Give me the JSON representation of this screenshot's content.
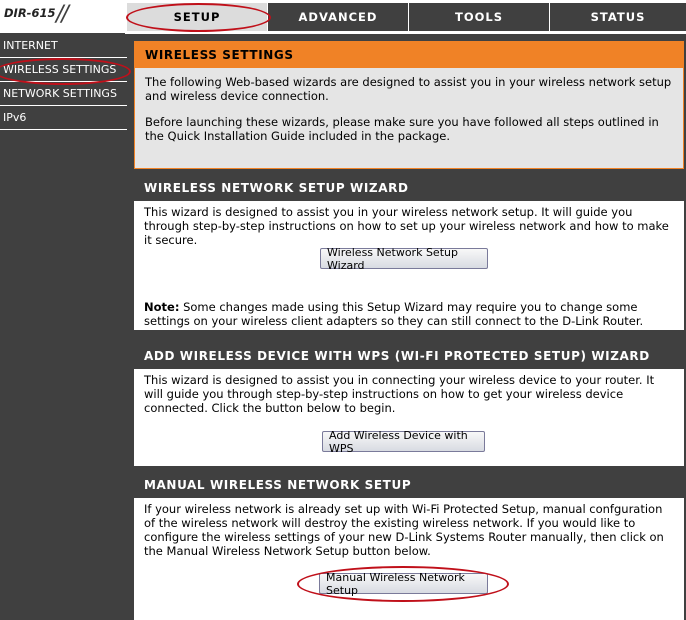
{
  "model": {
    "name": "DIR-615",
    "slashes": "//"
  },
  "tabs": [
    {
      "label": "SETUP",
      "active": true
    },
    {
      "label": "ADVANCED"
    },
    {
      "label": "TOOLS"
    },
    {
      "label": "STATUS"
    }
  ],
  "sidebar": {
    "items": [
      {
        "label": "INTERNET"
      },
      {
        "label": "WIRELESS SETTINGS",
        "active": true
      },
      {
        "label": "NETWORK SETTINGS"
      },
      {
        "label": "IPv6"
      }
    ]
  },
  "intro": {
    "title": "WIRELESS SETTINGS",
    "p1": "The following Web-based wizards are designed to assist you in your wireless network setup and wireless device connection.",
    "p2": "Before launching these wizards, please make sure you have followed all steps outlined in the Quick Installation Guide included in the package."
  },
  "wizard": {
    "title": "WIRELESS NETWORK SETUP WIZARD",
    "text": "This wizard is designed to assist you in your wireless network setup. It will guide you through step-by-step instructions on how to set up your wireless network and how to make it secure.",
    "button": "Wireless Network Setup Wizard",
    "note_label": "Note:",
    "note_text": " Some changes made using this Setup Wizard may require you to change some settings on your wireless client adapters so they can still connect to the D-Link Router."
  },
  "wps": {
    "title": "ADD WIRELESS DEVICE WITH WPS (WI-FI PROTECTED SETUP) WIZARD",
    "text": "This wizard is designed to assist you in connecting your wireless device to your router. It will guide you through step-by-step instructions on how to get your wireless device connected. Click the button below to begin.",
    "button": "Add Wireless Device with WPS"
  },
  "manual": {
    "title": "MANUAL WIRELESS NETWORK SETUP",
    "text": "If your wireless network is already set up with Wi-Fi Protected Setup, manual confguration of the wireless network will destroy the existing wireless network. If you would like to configure the wireless settings of your new D-Link Systems Router manually, then click on the Manual Wireless Network Setup button below.",
    "button": "Manual Wireless Network Setup"
  },
  "colors": {
    "dark_gray": "#404040",
    "orange": "#f08226",
    "highlight_oval": "#c0101a"
  }
}
